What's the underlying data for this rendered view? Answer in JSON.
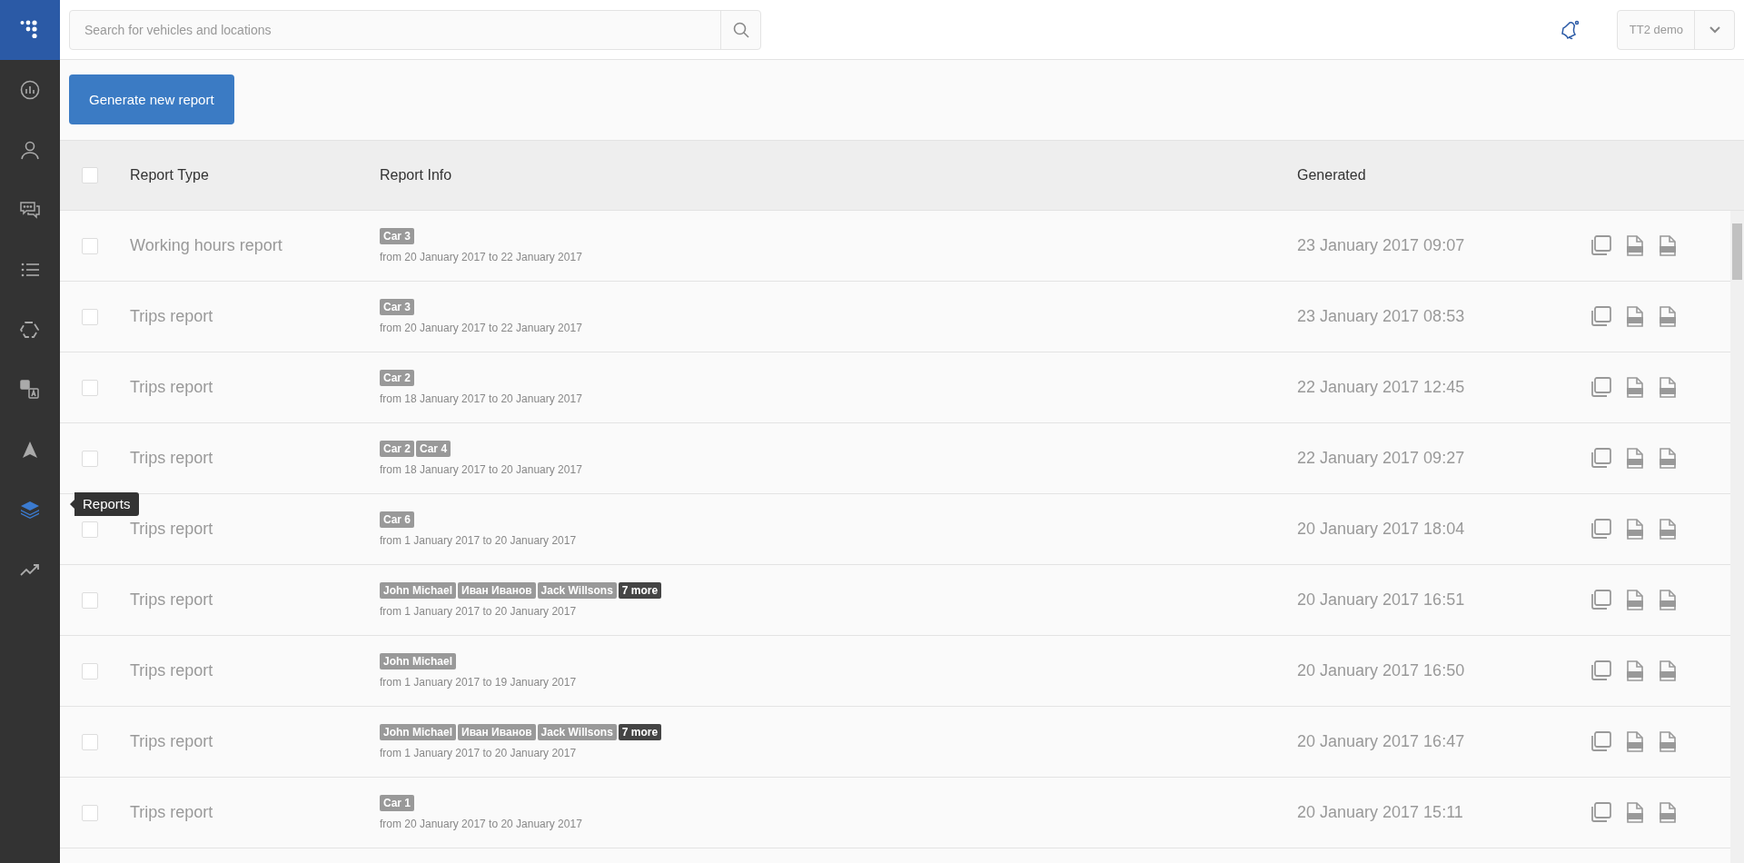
{
  "sidebar": {
    "items": [
      {
        "kind": "dashboard",
        "selected": false
      },
      {
        "kind": "person",
        "selected": false
      },
      {
        "kind": "chat",
        "selected": false
      },
      {
        "kind": "list",
        "selected": false
      },
      {
        "kind": "hexagon",
        "selected": false
      },
      {
        "kind": "translate",
        "selected": false
      },
      {
        "kind": "navigation",
        "selected": false
      },
      {
        "kind": "layers",
        "selected": true
      },
      {
        "kind": "trend",
        "selected": false
      }
    ],
    "tooltip": "Reports"
  },
  "search": {
    "placeholder": "Search for vehicles and locations"
  },
  "account": {
    "label": "TT2 demo"
  },
  "generate_button": "Generate new report",
  "table": {
    "select_all_checked": false,
    "columns": [
      "Report Type",
      "Report Info",
      "Generated"
    ],
    "rows": [
      {
        "checked": false,
        "type": "Working hours report",
        "tags": [
          {
            "kind": "item",
            "label": "Car 3"
          }
        ],
        "period": "from 20 January 2017 to 22 January 2017",
        "generated": "23 January 2017 09:07"
      },
      {
        "checked": false,
        "type": "Trips report",
        "tags": [
          {
            "kind": "item",
            "label": "Car 3"
          }
        ],
        "period": "from 20 January 2017 to 22 January 2017",
        "generated": "23 January 2017 08:53"
      },
      {
        "checked": false,
        "type": "Trips report",
        "tags": [
          {
            "kind": "item",
            "label": "Car 2"
          }
        ],
        "period": "from 18 January 2017 to 20 January 2017",
        "generated": "22 January 2017 12:45"
      },
      {
        "checked": false,
        "type": "Trips report",
        "tags": [
          {
            "kind": "item",
            "label": "Car 2"
          },
          {
            "kind": "item",
            "label": "Car 4"
          }
        ],
        "period": "from 18 January 2017 to 20 January 2017",
        "generated": "22 January 2017 09:27"
      },
      {
        "checked": false,
        "type": "Trips report",
        "tags": [
          {
            "kind": "item",
            "label": "Car 6"
          }
        ],
        "period": "from 1 January 2017 to 20 January 2017",
        "generated": "20 January 2017 18:04"
      },
      {
        "checked": false,
        "type": "Trips report",
        "tags": [
          {
            "kind": "item",
            "label": "John Michael"
          },
          {
            "kind": "item",
            "label": "Иван Иванов"
          },
          {
            "kind": "item",
            "label": "Jack Willsons"
          },
          {
            "kind": "more",
            "label": "7 more"
          }
        ],
        "period": "from 1 January 2017 to 20 January 2017",
        "generated": "20 January 2017 16:51"
      },
      {
        "checked": false,
        "type": "Trips report",
        "tags": [
          {
            "kind": "item",
            "label": "John Michael"
          }
        ],
        "period": "from 1 January 2017 to 19 January 2017",
        "generated": "20 January 2017 16:50"
      },
      {
        "checked": false,
        "type": "Trips report",
        "tags": [
          {
            "kind": "item",
            "label": "John Michael"
          },
          {
            "kind": "item",
            "label": "Иван Иванов"
          },
          {
            "kind": "item",
            "label": "Jack Willsons"
          },
          {
            "kind": "more",
            "label": "7 more"
          }
        ],
        "period": "from 1 January 2017 to 20 January 2017",
        "generated": "20 January 2017 16:47"
      },
      {
        "checked": false,
        "type": "Trips report",
        "tags": [
          {
            "kind": "item",
            "label": "Car 1"
          }
        ],
        "period": "from 20 January 2017 to 20 January 2017",
        "generated": "20 January 2017 15:11"
      }
    ]
  }
}
